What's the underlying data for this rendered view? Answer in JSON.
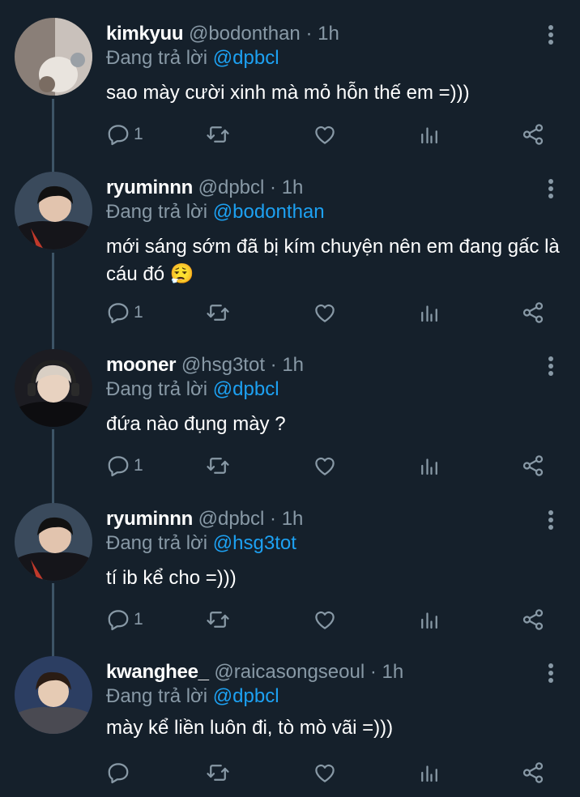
{
  "reply_prefix": "Đang trả lời",
  "colors": {
    "background": "#15202b",
    "secondary_text": "#8899a6",
    "mention": "#1da1f2",
    "thread_line": "#3d5466"
  },
  "tweets": [
    {
      "name": "kimkyuu",
      "handle": "@bodonthan",
      "dot": "·",
      "time": "1h",
      "replying_to": "@dpbcl",
      "text": "sao mày cười xinh mà mỏ hỗn thế em =)))",
      "reply_count": "1",
      "avatar_icon": "cat-photo-avatar"
    },
    {
      "name": "ryuminnn",
      "handle": "@dpbcl",
      "dot": "·",
      "time": "1h",
      "replying_to": "@bodonthan",
      "text": "mới sáng sớm đã bị kím chuyện nên em đang gấc là cáu đó 😮‍💨",
      "reply_count": "1",
      "avatar_icon": "person-photo-avatar"
    },
    {
      "name": "mooner",
      "handle": "@hsg3tot",
      "dot": "·",
      "time": "1h",
      "replying_to": "@dpbcl",
      "text": "đứa nào đụng mày ?",
      "reply_count": "1",
      "avatar_icon": "person-headset-avatar"
    },
    {
      "name": "ryuminnn",
      "handle": "@dpbcl",
      "dot": "·",
      "time": "1h",
      "replying_to": "@hsg3tot",
      "text": "tí ib kể cho =)))",
      "reply_count": "1",
      "avatar_icon": "person-photo-avatar"
    },
    {
      "name": "kwanghee_",
      "handle": "@raicasongseoul",
      "dot": "·",
      "time": "1h",
      "replying_to": "@dpbcl",
      "text": "mày kể liền luôn đi, tò mò vãi =)))",
      "reply_count": "",
      "avatar_icon": "person-photo-avatar"
    }
  ]
}
